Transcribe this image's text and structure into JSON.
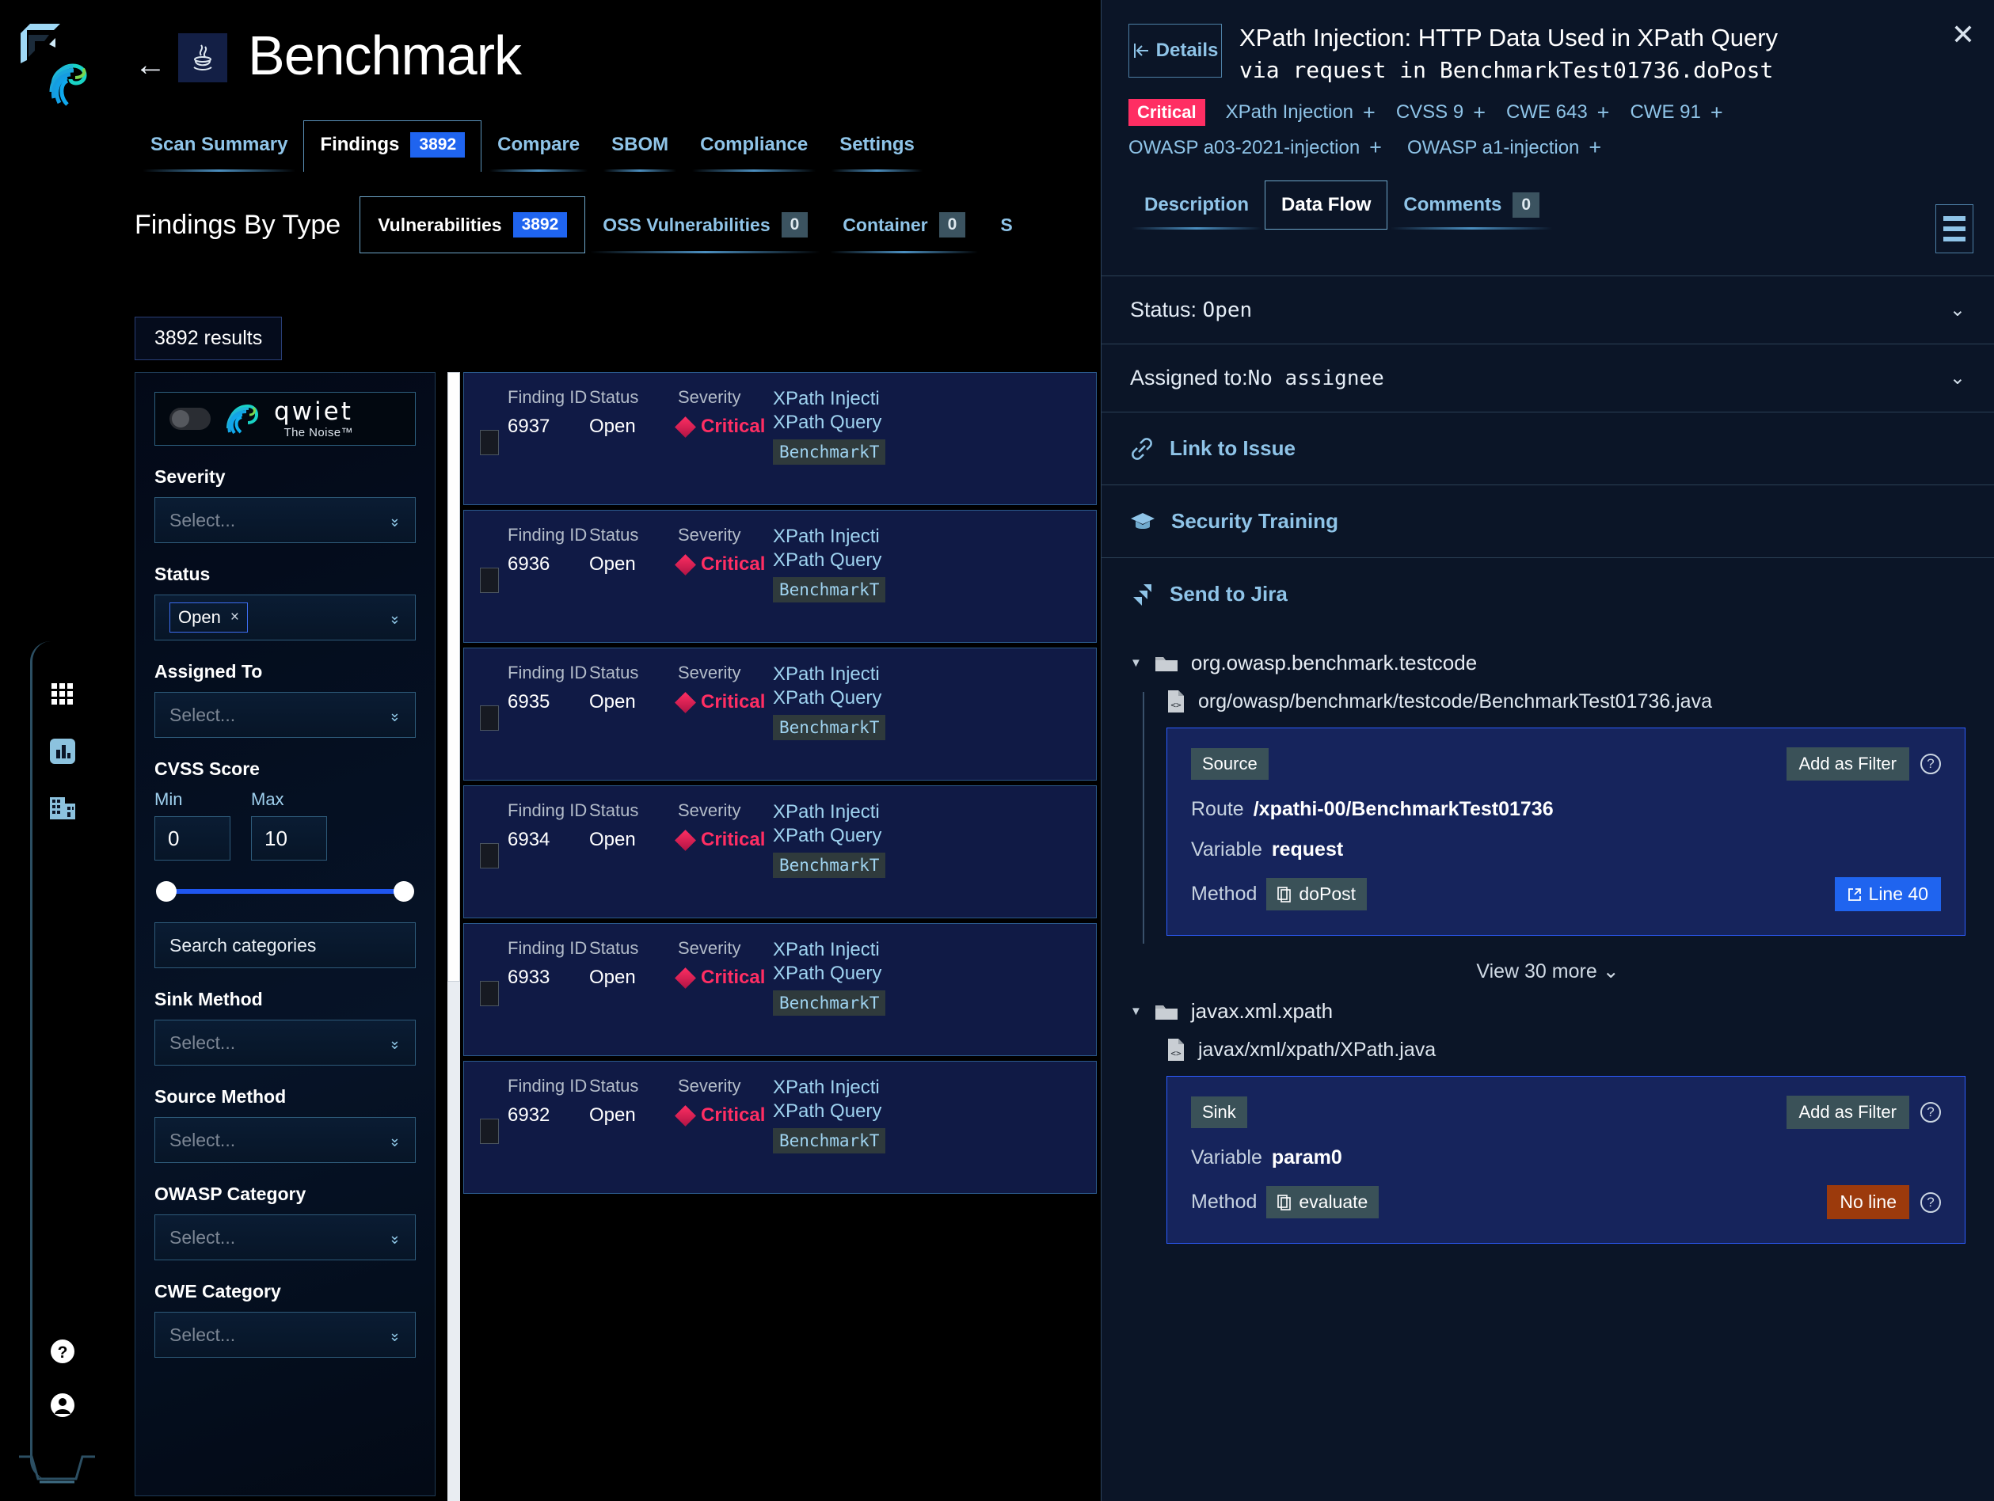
{
  "rail": {
    "logo_name": "qwiet-logo",
    "icons": [
      {
        "name": "apps-grid-icon"
      },
      {
        "name": "analytics-chart-icon"
      },
      {
        "name": "organization-building-icon"
      }
    ],
    "bottom_icons": [
      {
        "name": "help-circle-icon"
      },
      {
        "name": "user-profile-icon"
      }
    ]
  },
  "header": {
    "back_label": "←",
    "app_icon_name": "java-icon",
    "title": "Benchmark"
  },
  "nav_tabs": [
    {
      "label": "Scan Summary",
      "count": null,
      "active": false
    },
    {
      "label": "Findings",
      "count": "3892",
      "active": true
    },
    {
      "label": "Compare",
      "count": null,
      "active": false
    },
    {
      "label": "SBOM",
      "count": null,
      "active": false
    },
    {
      "label": "Compliance",
      "count": null,
      "active": false
    },
    {
      "label": "Settings",
      "count": null,
      "active": false
    }
  ],
  "findings_by_type": {
    "label": "Findings By Type",
    "tabs": [
      {
        "label": "Vulnerabilities",
        "count": "3892",
        "active": true
      },
      {
        "label": "OSS Vulnerabilities",
        "count": "0",
        "active": false
      },
      {
        "label": "Container",
        "count": "0",
        "active": false
      },
      {
        "label": "S",
        "count": null,
        "active": false
      }
    ]
  },
  "results_badge": "3892 results",
  "filters": {
    "brand": {
      "main": "qwiet",
      "sub": "The Noise™"
    },
    "severity": {
      "label": "Severity",
      "placeholder": "Select..."
    },
    "status": {
      "label": "Status",
      "selected": "Open",
      "remove": "×"
    },
    "assigned_to": {
      "label": "Assigned To",
      "placeholder": "Select..."
    },
    "cvss": {
      "label": "CVSS Score",
      "min_label": "Min",
      "max_label": "Max",
      "min": "0",
      "max": "10"
    },
    "search_categories": "Search categories",
    "sink_method": {
      "label": "Sink Method",
      "placeholder": "Select..."
    },
    "source_method": {
      "label": "Source Method",
      "placeholder": "Select..."
    },
    "owasp_category": {
      "label": "OWASP Category",
      "placeholder": "Select..."
    },
    "cwe_category": {
      "label": "CWE Category",
      "placeholder": "Select..."
    }
  },
  "findings_columns": {
    "id": "Finding ID",
    "status": "Status",
    "severity": "Severity"
  },
  "findings": [
    {
      "id": "6937",
      "status": "Open",
      "severity": "Critical",
      "title1": "XPath Injecti",
      "title2": "XPath Query",
      "chip": "BenchmarkT"
    },
    {
      "id": "6936",
      "status": "Open",
      "severity": "Critical",
      "title1": "XPath Injecti",
      "title2": "XPath Query",
      "chip": "BenchmarkT"
    },
    {
      "id": "6935",
      "status": "Open",
      "severity": "Critical",
      "title1": "XPath Injecti",
      "title2": "XPath Query",
      "chip": "BenchmarkT"
    },
    {
      "id": "6934",
      "status": "Open",
      "severity": "Critical",
      "title1": "XPath Injecti",
      "title2": "XPath Query",
      "chip": "BenchmarkT"
    },
    {
      "id": "6933",
      "status": "Open",
      "severity": "Critical",
      "title1": "XPath Injecti",
      "title2": "XPath Query",
      "chip": "BenchmarkT"
    },
    {
      "id": "6932",
      "status": "Open",
      "severity": "Critical",
      "title1": "XPath Injecti",
      "title2": "XPath Query",
      "chip": "BenchmarkT"
    }
  ],
  "panel": {
    "details_button": "Details",
    "title_line1": "XPath Injection: HTTP Data Used in XPath Query",
    "title_via": "via ",
    "title_request": "request",
    "title_in": " in ",
    "title_method": "BenchmarkTest01736.doPost",
    "close": "✕",
    "severity_badge": "Critical",
    "badges": [
      {
        "label": "XPath Injection",
        "plus": "+"
      },
      {
        "label": "CVSS 9",
        "plus": "+"
      },
      {
        "label": "CWE 643",
        "plus": "+"
      },
      {
        "label": "CWE 91",
        "plus": "+"
      }
    ],
    "badges_row2": [
      {
        "label": "OWASP a03-2021-injection",
        "plus": "+"
      },
      {
        "label": "OWASP a1-injection",
        "plus": "+"
      }
    ],
    "tabs": [
      {
        "label": "Description",
        "count": null,
        "active": false
      },
      {
        "label": "Data Flow",
        "count": null,
        "active": true
      },
      {
        "label": "Comments",
        "count": "0",
        "active": false
      }
    ],
    "status_row": {
      "prefix": "Status: ",
      "value": "Open"
    },
    "assignee_row": {
      "prefix": "Assigned to:",
      "value": "No assignee"
    },
    "actions": [
      {
        "label": "Link to Issue",
        "icon": "link-icon"
      },
      {
        "label": "Security Training",
        "icon": "graduation-cap-icon"
      },
      {
        "label": "Send to Jira",
        "icon": "jira-icon"
      }
    ],
    "dataflow": {
      "source_group": {
        "package": "org.owasp.benchmark.testcode",
        "file": "org/owasp/benchmark/testcode/BenchmarkTest01736.java",
        "card": {
          "tag": "Source",
          "add_as_filter": "Add as Filter",
          "help": "?",
          "route_label": "Route",
          "route_value": "/xpathi-00/BenchmarkTest01736",
          "variable_label": "Variable",
          "variable_value": "request",
          "method_label": "Method",
          "method_value": "doPost",
          "line_badge": "Line 40"
        }
      },
      "view_more": "View 30 more",
      "sink_group": {
        "package": "javax.xml.xpath",
        "file": "javax/xml/xpath/XPath.java",
        "card": {
          "tag": "Sink",
          "add_as_filter": "Add as Filter",
          "help": "?",
          "variable_label": "Variable",
          "variable_value": "param0",
          "method_label": "Method",
          "method_value": "evaluate",
          "line_badge": "No line"
        }
      }
    }
  }
}
